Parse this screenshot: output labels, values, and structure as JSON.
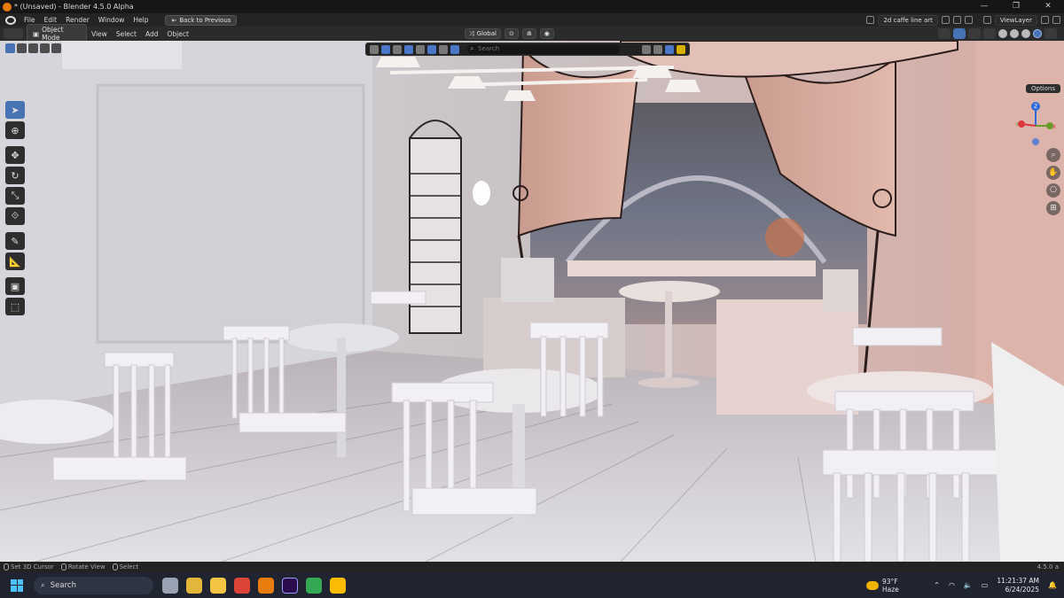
{
  "window": {
    "title": "* (Unsaved) - Blender 4.5.0 Alpha",
    "controls": [
      "—",
      "❐",
      "✕"
    ]
  },
  "menu": {
    "items": [
      "File",
      "Edit",
      "Render",
      "Window",
      "Help"
    ],
    "back_button": "Back to Previous",
    "scene_name": "2d caffe line art",
    "view_layer": "ViewLayer"
  },
  "viewport_header": {
    "mode": "Object Mode",
    "menus": [
      "View",
      "Select",
      "Add",
      "Object"
    ],
    "transform_orientation": "Global",
    "options_label": "Options"
  },
  "shading_popover": {
    "search_placeholder": "Search"
  },
  "gizmo": {
    "axes": [
      "Z",
      "Y",
      "X"
    ],
    "colors": {
      "x": "#d9363e",
      "y": "#6a9a2a",
      "z": "#2e6bd9"
    }
  },
  "statusbar": {
    "hints": [
      "Set 3D Cursor",
      "Rotate View",
      "Select"
    ],
    "version": "4.5.0 a"
  },
  "taskbar": {
    "search_label": "Search",
    "weather_temp": "93°F",
    "weather_desc": "Haze",
    "time": "11:21:37 AM",
    "date": "6/24/2025"
  },
  "colors": {
    "accent": "#4772b3",
    "blender_orange": "#e87d0d"
  }
}
